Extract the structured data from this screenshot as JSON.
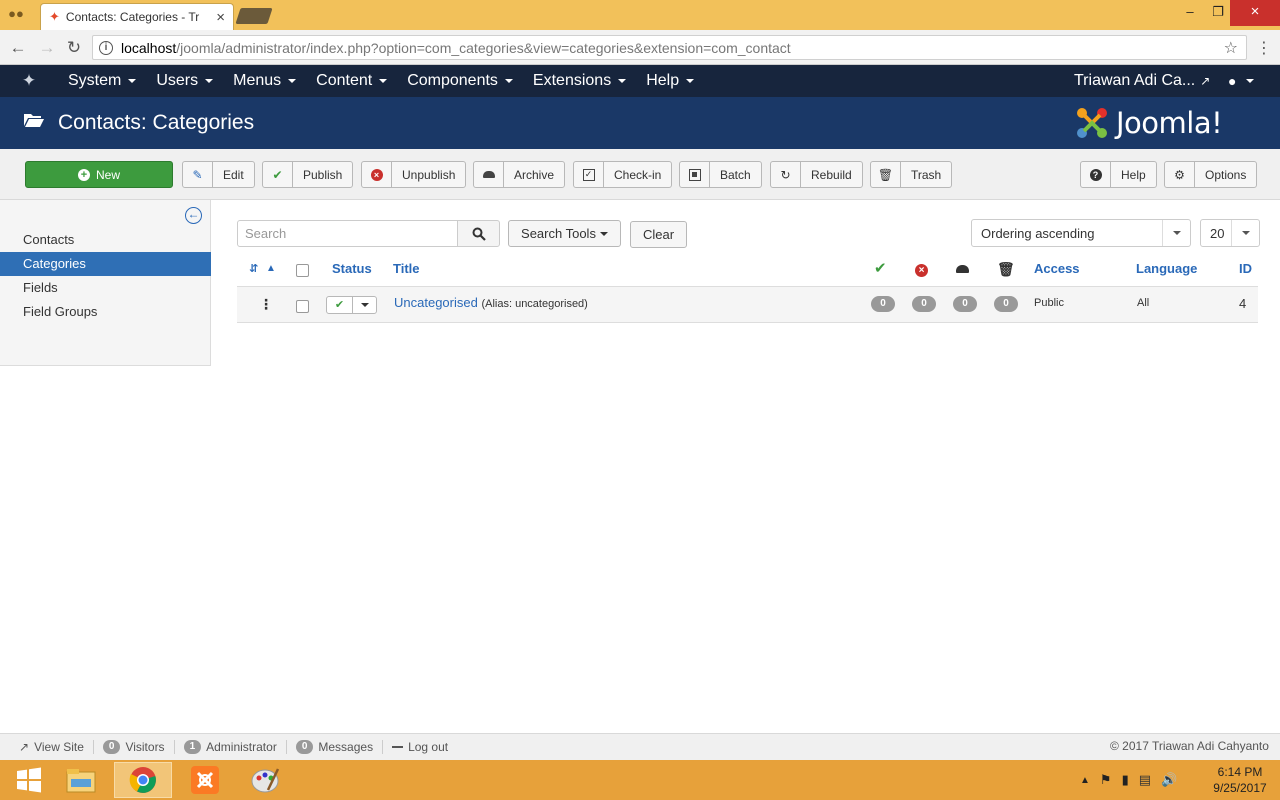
{
  "browser": {
    "tab_title": "Contacts: Categories - Tr",
    "url_host": "localhost",
    "url_path": "/joomla/administrator/index.php?option=com_categories&view=categories&extension=com_contact"
  },
  "topnav": {
    "items": [
      {
        "label": "System"
      },
      {
        "label": "Users"
      },
      {
        "label": "Menus"
      },
      {
        "label": "Content"
      },
      {
        "label": "Components"
      },
      {
        "label": "Extensions"
      },
      {
        "label": "Help"
      }
    ],
    "user_name": "Triawan Adi Ca..."
  },
  "header": {
    "title": "Contacts: Categories",
    "logo_text": "Joomla!"
  },
  "toolbar": {
    "new": "New",
    "edit": "Edit",
    "publish": "Publish",
    "unpublish": "Unpublish",
    "archive": "Archive",
    "checkin": "Check-in",
    "batch": "Batch",
    "rebuild": "Rebuild",
    "trash": "Trash",
    "help": "Help",
    "options": "Options"
  },
  "sidebar": {
    "items": [
      {
        "label": "Contacts",
        "active": false
      },
      {
        "label": "Categories",
        "active": true
      },
      {
        "label": "Fields",
        "active": false
      },
      {
        "label": "Field Groups",
        "active": false
      }
    ]
  },
  "filters": {
    "search_placeholder": "Search",
    "search_tools": "Search Tools",
    "clear": "Clear",
    "ordering": "Ordering ascending",
    "limit": "20"
  },
  "table": {
    "headers": {
      "status": "Status",
      "title": "Title",
      "access": "Access",
      "language": "Language",
      "id": "ID"
    },
    "rows": [
      {
        "title": "Uncategorised",
        "alias": "(Alias: uncategorised)",
        "published": "0",
        "unpublished": "0",
        "archived": "0",
        "trashed": "0",
        "access": "Public",
        "language": "All",
        "id": "4"
      }
    ]
  },
  "status": {
    "view_site": "View Site",
    "visitors_count": "0",
    "visitors": "Visitors",
    "admin_count": "1",
    "administrator": "Administrator",
    "messages_count": "0",
    "messages": "Messages",
    "logout": "Log out",
    "copyright": "© 2017 Triawan Adi Cahyanto"
  },
  "taskbar": {
    "time": "6:14 PM",
    "date": "9/25/2017"
  },
  "colors": {
    "topnav_bg": "#17253d",
    "subhead_bg": "#1a3867",
    "new_button": "#3d9b3e",
    "sidebar_active": "#2f6fb5",
    "link": "#2a69b8"
  }
}
